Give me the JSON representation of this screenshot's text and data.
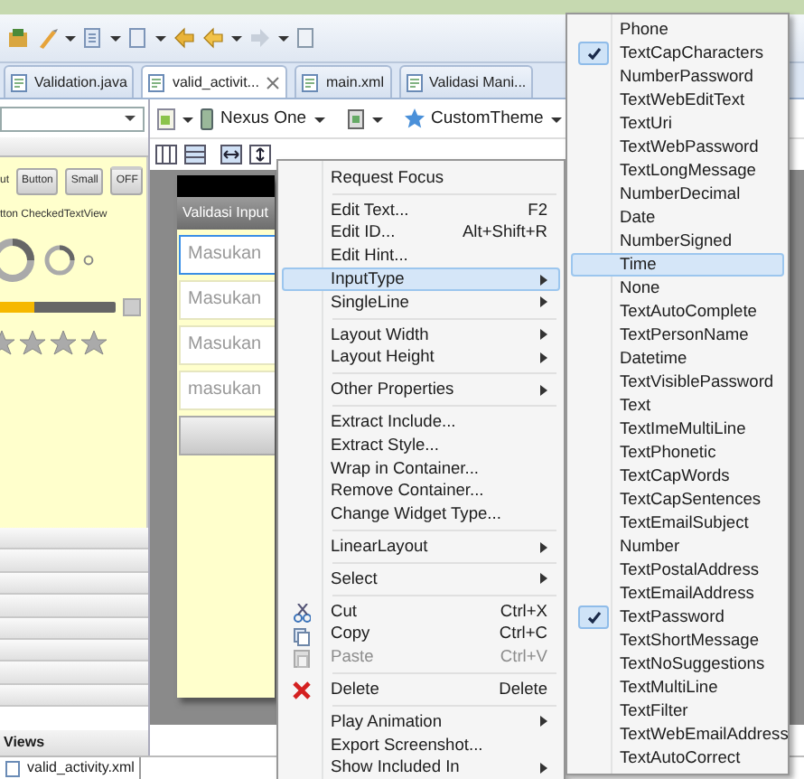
{
  "editor_tabs": [
    {
      "label": "Validation.java",
      "selected": false
    },
    {
      "label": "valid_activit...",
      "selected": true
    },
    {
      "label": "main.xml",
      "selected": false
    },
    {
      "label": "Validasi Mani...",
      "selected": false
    }
  ],
  "palette": {
    "preview_widgets": [
      {
        "kind": "text",
        "label": "ut"
      },
      {
        "kind": "button",
        "label": "Button"
      },
      {
        "kind": "button",
        "label": "Small"
      },
      {
        "kind": "toggle",
        "label": "OFF"
      }
    ],
    "preview_text": "tton CheckedTextView",
    "seek_bar": {
      "level": 0.3
    },
    "categories": [
      {
        "label": "Views"
      }
    ]
  },
  "layout_toolbar": {
    "device": "Nexus One",
    "theme": "CustomTheme"
  },
  "canvas": {
    "title": "Validasi Input",
    "fields": [
      {
        "hint": "Masukan",
        "selected": true
      },
      {
        "hint": "Masukan",
        "selected": false
      },
      {
        "hint": "Masukan",
        "selected": false
      },
      {
        "hint": "masukan",
        "selected": false
      }
    ]
  },
  "context_menu": [
    {
      "kind": "item",
      "label": "Request Focus",
      "selected": false,
      "disabled": false
    },
    {
      "kind": "separator"
    },
    {
      "kind": "item",
      "label": "Edit Text...",
      "shortcut": "F2",
      "selected": false,
      "disabled": false
    },
    {
      "kind": "item",
      "label": "Edit ID...",
      "shortcut": "Alt+Shift+R",
      "selected": false,
      "disabled": false
    },
    {
      "kind": "item",
      "label": "Edit Hint...",
      "selected": false,
      "disabled": false
    },
    {
      "kind": "item",
      "label": "InputType",
      "submenu": true,
      "selected": true,
      "disabled": false
    },
    {
      "kind": "item",
      "label": "SingleLine",
      "submenu": true,
      "selected": false,
      "disabled": false
    },
    {
      "kind": "separator"
    },
    {
      "kind": "item",
      "label": "Layout Width",
      "submenu": true,
      "selected": false,
      "disabled": false
    },
    {
      "kind": "item",
      "label": "Layout Height",
      "submenu": true,
      "selected": false,
      "disabled": false
    },
    {
      "kind": "separator"
    },
    {
      "kind": "item",
      "label": "Other Properties",
      "submenu": true,
      "selected": false,
      "disabled": false
    },
    {
      "kind": "separator"
    },
    {
      "kind": "item",
      "label": "Extract Include...",
      "selected": false,
      "disabled": false
    },
    {
      "kind": "item",
      "label": "Extract Style...",
      "selected": false,
      "disabled": false
    },
    {
      "kind": "item",
      "label": "Wrap in Container...",
      "selected": false,
      "disabled": false
    },
    {
      "kind": "item",
      "label": "Remove Container...",
      "selected": false,
      "disabled": false
    },
    {
      "kind": "item",
      "label": "Change Widget Type...",
      "selected": false,
      "disabled": false
    },
    {
      "kind": "separator"
    },
    {
      "kind": "item",
      "label": "LinearLayout",
      "submenu": true,
      "selected": false,
      "disabled": false
    },
    {
      "kind": "separator"
    },
    {
      "kind": "item",
      "label": "Select",
      "submenu": true,
      "selected": false,
      "disabled": false
    },
    {
      "kind": "separator"
    },
    {
      "kind": "cut",
      "label": "Cut",
      "shortcut": "Ctrl+X",
      "selected": false,
      "disabled": false
    },
    {
      "kind": "copy",
      "label": "Copy",
      "shortcut": "Ctrl+C",
      "selected": false,
      "disabled": false
    },
    {
      "kind": "paste",
      "label": "Paste",
      "shortcut": "Ctrl+V",
      "selected": false,
      "disabled": true
    },
    {
      "kind": "separator"
    },
    {
      "kind": "delete",
      "label": "Delete",
      "shortcut": "Delete",
      "selected": false,
      "disabled": false
    },
    {
      "kind": "separator"
    },
    {
      "kind": "item",
      "label": "Play Animation",
      "submenu": true,
      "selected": false,
      "disabled": false
    },
    {
      "kind": "item",
      "label": "Export Screenshot...",
      "selected": false,
      "disabled": false
    },
    {
      "kind": "item",
      "label": "Show Included In",
      "submenu": true,
      "selected": false,
      "disabled": false
    }
  ],
  "input_type_menu": [
    {
      "label": "Phone",
      "checked": false,
      "selected": false
    },
    {
      "label": "TextCapCharacters",
      "checked": true,
      "selected": false
    },
    {
      "label": "NumberPassword",
      "checked": false,
      "selected": false
    },
    {
      "label": "TextWebEditText",
      "checked": false,
      "selected": false
    },
    {
      "label": "TextUri",
      "checked": false,
      "selected": false
    },
    {
      "label": "TextWebPassword",
      "checked": false,
      "selected": false
    },
    {
      "label": "TextLongMessage",
      "checked": false,
      "selected": false
    },
    {
      "label": "NumberDecimal",
      "checked": false,
      "selected": false
    },
    {
      "label": "Date",
      "checked": false,
      "selected": false
    },
    {
      "label": "NumberSigned",
      "checked": false,
      "selected": false
    },
    {
      "label": "Time",
      "checked": false,
      "selected": true
    },
    {
      "label": "None",
      "checked": false,
      "selected": false
    },
    {
      "label": "TextAutoComplete",
      "checked": false,
      "selected": false
    },
    {
      "label": "TextPersonName",
      "checked": false,
      "selected": false
    },
    {
      "label": "Datetime",
      "checked": false,
      "selected": false
    },
    {
      "label": "TextVisiblePassword",
      "checked": false,
      "selected": false
    },
    {
      "label": "Text",
      "checked": false,
      "selected": false
    },
    {
      "label": "TextImeMultiLine",
      "checked": false,
      "selected": false
    },
    {
      "label": "TextPhonetic",
      "checked": false,
      "selected": false
    },
    {
      "label": "TextCapWords",
      "checked": false,
      "selected": false
    },
    {
      "label": "TextCapSentences",
      "checked": false,
      "selected": false
    },
    {
      "label": "TextEmailSubject",
      "checked": false,
      "selected": false
    },
    {
      "label": "Number",
      "checked": false,
      "selected": false
    },
    {
      "label": "TextPostalAddress",
      "checked": false,
      "selected": false
    },
    {
      "label": "TextEmailAddress",
      "checked": false,
      "selected": false
    },
    {
      "label": "TextPassword",
      "checked": true,
      "selected": false
    },
    {
      "label": "TextShortMessage",
      "checked": false,
      "selected": false
    },
    {
      "label": "TextNoSuggestions",
      "checked": false,
      "selected": false
    },
    {
      "label": "TextMultiLine",
      "checked": false,
      "selected": false
    },
    {
      "label": "TextFilter",
      "checked": false,
      "selected": false
    },
    {
      "label": "TextWebEmailAddress",
      "checked": false,
      "selected": false
    },
    {
      "label": "TextAutoCorrect",
      "checked": false,
      "selected": false
    }
  ],
  "bottom_tab": {
    "label": "valid_activity.xml"
  }
}
